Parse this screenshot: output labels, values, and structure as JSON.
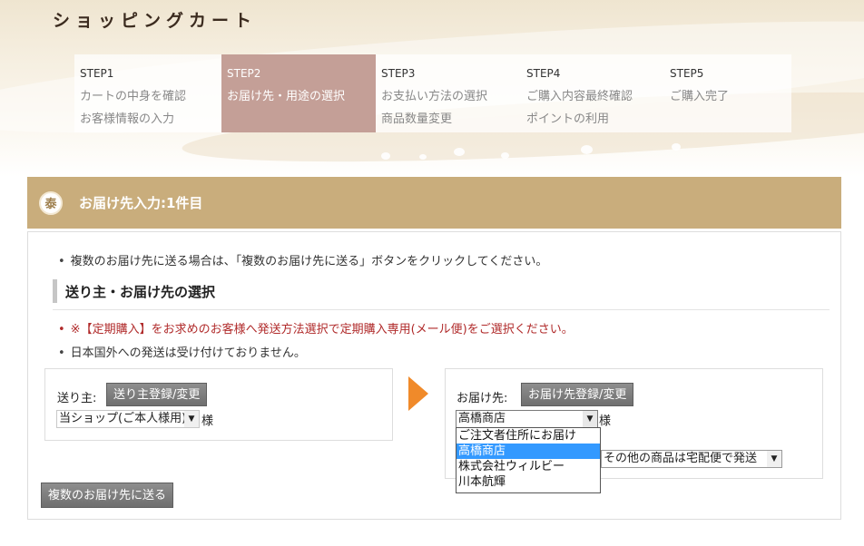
{
  "header": {
    "title": "ショッピングカート"
  },
  "steps": [
    {
      "num": "STEP1",
      "line1": "カートの中身を確認",
      "line2": "お客様情報の入力",
      "active": false
    },
    {
      "num": "STEP2",
      "line1": "お届け先・用途の選択",
      "line2": "",
      "active": true
    },
    {
      "num": "STEP3",
      "line1": "お支払い方法の選択",
      "line2": "商品数量変更",
      "active": false
    },
    {
      "num": "STEP4",
      "line1": "ご購入内容最終確認",
      "line2": "ポイントの利用",
      "active": false
    },
    {
      "num": "STEP5",
      "line1": "ご購入完了",
      "line2": "",
      "active": false
    }
  ],
  "section": {
    "seal_char": "泰",
    "title": "お届け先入力:1件目"
  },
  "notes": {
    "multi": "複数のお届け先に送る場合は、「複数のお届け先に送る」ボタンをクリックしてください。",
    "subscription": "※【定期購入】をお求めのお客様へ発送方法選択で定期購入専用(メール便)をご選択ください。",
    "overseas": "日本国外への発送は受け付けておりません。"
  },
  "sub_heading": "送り主・お届け先の選択",
  "sender": {
    "label": "送り主:",
    "register_button": "送り主登録/変更",
    "selected": "当ショップ(ご本人様用)",
    "suffix": "様"
  },
  "recipient": {
    "label": "お届け先:",
    "register_button": "お届け先登録/変更",
    "selected": "高橋商店",
    "suffix": "様",
    "options": [
      "ご注文者住所にお届け",
      "高橋商店",
      "株式会社ウィルビー",
      "川本航輝"
    ],
    "selected_index": 1
  },
  "shipping": {
    "selected": "その他の商品は宅配便で発送"
  },
  "multi_address_button": "複数のお届け先に送る",
  "colors": {
    "active_step": "#c49f97",
    "section_bar": "#c9ad7c",
    "notice_red": "#b02a2a",
    "arrow": "#f08a2a",
    "selected_option": "#3399ff"
  }
}
